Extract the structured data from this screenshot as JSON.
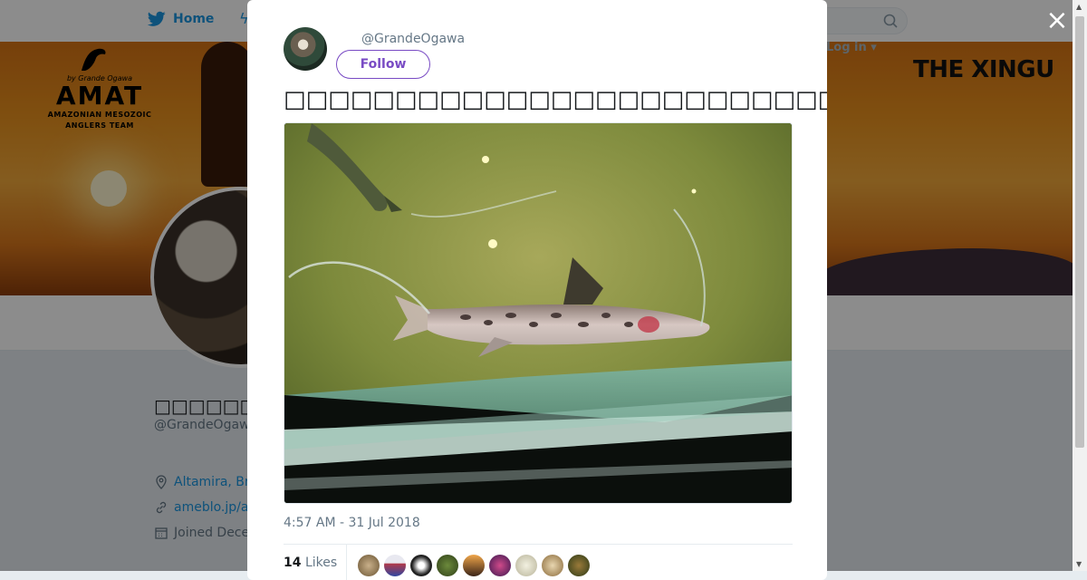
{
  "background_page": {
    "nav": {
      "home_label": "Home",
      "login_label": "Log in"
    },
    "banner": {
      "logo": {
        "by_line": "by Grande Ogawa",
        "title": "AMAT",
        "subtitle_line1": "AMAZONIAN MESOZOIC",
        "subtitle_line2": "ANGLERS TEAM"
      },
      "right_title": "THE XINGU"
    },
    "profile": {
      "name": "□□□□□□□□",
      "handle": "@GrandeOgaw",
      "location": "Altamira, Br",
      "website": "ameblo.jp/a",
      "joined": "Joined Dece"
    }
  },
  "modal": {
    "close_glyph": "×",
    "tweet": {
      "handle": "@GrandeOgawa",
      "follow_label": "Follow",
      "text": "□□□□□□□□□□□□□□□□□□□□□□□□□□□",
      "hashtag": "#□□□",
      "timestamp": "4:57 AM - 31 Jul 2018",
      "likes_count": "14",
      "likes_label": "Likes"
    }
  },
  "colors": {
    "accent": "#794bc4",
    "twitter_blue": "#1b95e0",
    "muted": "#657786"
  },
  "icons": {
    "home": "twitter-bird-icon",
    "search": "search-icon",
    "close": "close-icon",
    "location": "location-pin-icon",
    "link": "link-icon",
    "calendar": "calendar-icon"
  }
}
